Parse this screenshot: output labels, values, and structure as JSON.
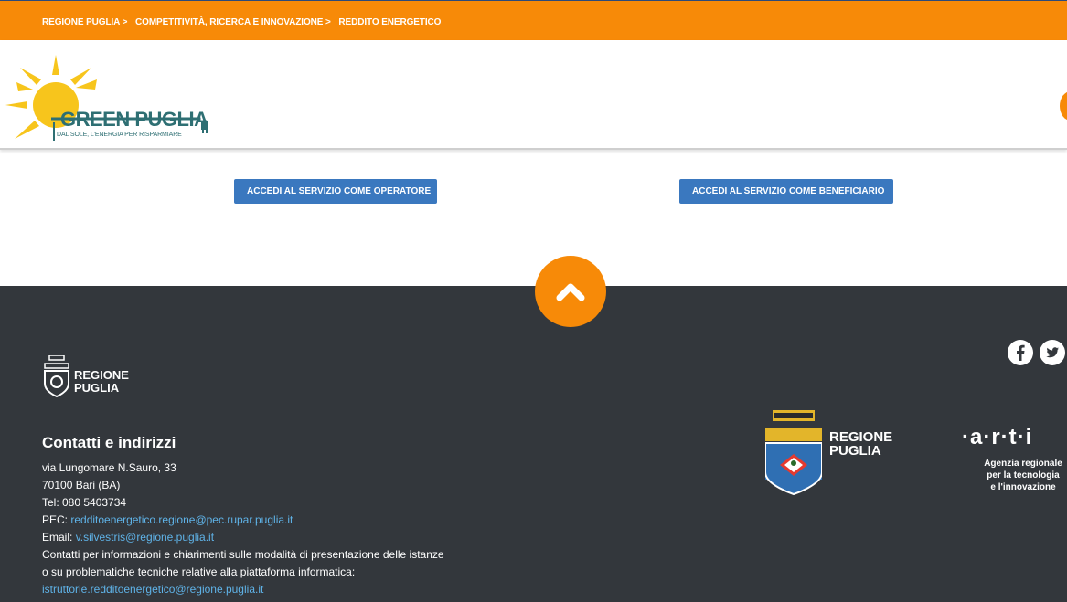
{
  "breadcrumb": {
    "items": [
      "REGIONE PUGLIA >",
      "COMPETITIVITÀ, RICERCA E INNOVAZIONE >",
      "REDDITO ENERGETICO"
    ]
  },
  "logo": {
    "title": "GREEN PUGLIA",
    "subtitle": "DAL SOLE, L'ENERGIA PER RISPARMIARE"
  },
  "buttons": {
    "operator": "ACCEDI AL SERVIZIO COME OPERATORE",
    "beneficiary": "ACCEDI AL SERVIZIO COME BENEFICIARIO"
  },
  "footer": {
    "region_name_line1": "REGIONE",
    "region_name_line2": "PUGLIA",
    "contacts_title": "Contatti e indirizzi",
    "address_street": "via Lungomare N.Sauro, 33",
    "address_city": "70100 Bari (BA)",
    "tel": "Tel: 080 5403734",
    "pec_label": "PEC:",
    "pec_value": "redditoenergetico.regione@pec.rupar.puglia.it",
    "email_label": "Email:",
    "email_value": "v.silvestris@regione.puglia.it",
    "info_line1": "Contatti per informazioni e chiarimenti sulle modalità di presentazione delle istanze",
    "info_line2": "o su problematiche tecniche relative alla piattaforma informatica:",
    "info_email": "istruttorie.redditoenergetico@regione.puglia.it",
    "arti_logo": "·a·r·t·i",
    "arti_sub1": "Agenzia regionale",
    "arti_sub2": "per la tecnologia",
    "arti_sub3": "e l'innovazione"
  },
  "colors": {
    "accent": "#f78a08",
    "button": "#3a78bf",
    "footer_bg": "#33373c",
    "link": "#5fb3e8"
  },
  "icons": {
    "scroll_top": "chevron-up-icon",
    "facebook": "facebook-icon",
    "twitter": "twitter-icon"
  }
}
